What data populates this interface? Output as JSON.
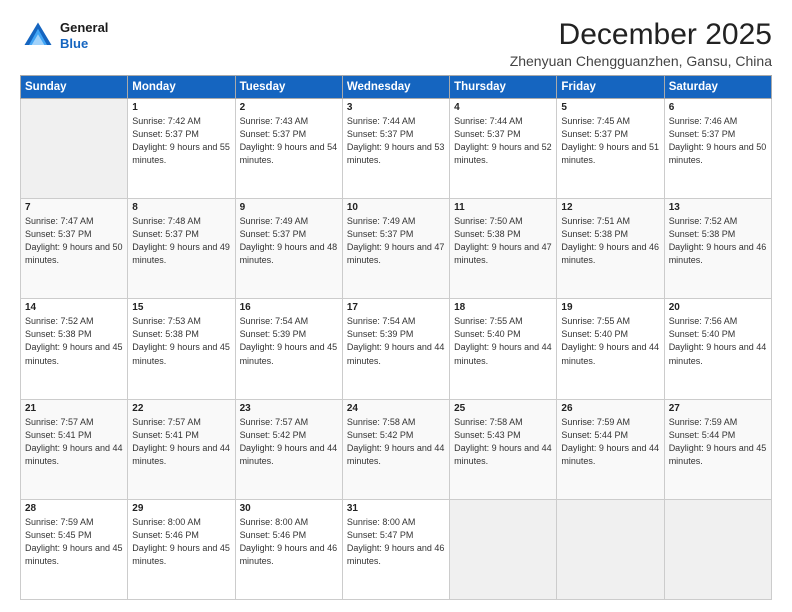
{
  "logo": {
    "line1": "General",
    "line2": "Blue"
  },
  "title": "December 2025",
  "location": "Zhenyuan Chengguanzhen, Gansu, China",
  "weekdays": [
    "Sunday",
    "Monday",
    "Tuesday",
    "Wednesday",
    "Thursday",
    "Friday",
    "Saturday"
  ],
  "weeks": [
    [
      {
        "day": "",
        "content": ""
      },
      {
        "day": "1",
        "content": "Sunrise: 7:42 AM\nSunset: 5:37 PM\nDaylight: 9 hours\nand 55 minutes."
      },
      {
        "day": "2",
        "content": "Sunrise: 7:43 AM\nSunset: 5:37 PM\nDaylight: 9 hours\nand 54 minutes."
      },
      {
        "day": "3",
        "content": "Sunrise: 7:44 AM\nSunset: 5:37 PM\nDaylight: 9 hours\nand 53 minutes."
      },
      {
        "day": "4",
        "content": "Sunrise: 7:44 AM\nSunset: 5:37 PM\nDaylight: 9 hours\nand 52 minutes."
      },
      {
        "day": "5",
        "content": "Sunrise: 7:45 AM\nSunset: 5:37 PM\nDaylight: 9 hours\nand 51 minutes."
      },
      {
        "day": "6",
        "content": "Sunrise: 7:46 AM\nSunset: 5:37 PM\nDaylight: 9 hours\nand 50 minutes."
      }
    ],
    [
      {
        "day": "7",
        "content": "Sunrise: 7:47 AM\nSunset: 5:37 PM\nDaylight: 9 hours\nand 50 minutes."
      },
      {
        "day": "8",
        "content": "Sunrise: 7:48 AM\nSunset: 5:37 PM\nDaylight: 9 hours\nand 49 minutes."
      },
      {
        "day": "9",
        "content": "Sunrise: 7:49 AM\nSunset: 5:37 PM\nDaylight: 9 hours\nand 48 minutes."
      },
      {
        "day": "10",
        "content": "Sunrise: 7:49 AM\nSunset: 5:37 PM\nDaylight: 9 hours\nand 47 minutes."
      },
      {
        "day": "11",
        "content": "Sunrise: 7:50 AM\nSunset: 5:38 PM\nDaylight: 9 hours\nand 47 minutes."
      },
      {
        "day": "12",
        "content": "Sunrise: 7:51 AM\nSunset: 5:38 PM\nDaylight: 9 hours\nand 46 minutes."
      },
      {
        "day": "13",
        "content": "Sunrise: 7:52 AM\nSunset: 5:38 PM\nDaylight: 9 hours\nand 46 minutes."
      }
    ],
    [
      {
        "day": "14",
        "content": "Sunrise: 7:52 AM\nSunset: 5:38 PM\nDaylight: 9 hours\nand 45 minutes."
      },
      {
        "day": "15",
        "content": "Sunrise: 7:53 AM\nSunset: 5:38 PM\nDaylight: 9 hours\nand 45 minutes."
      },
      {
        "day": "16",
        "content": "Sunrise: 7:54 AM\nSunset: 5:39 PM\nDaylight: 9 hours\nand 45 minutes."
      },
      {
        "day": "17",
        "content": "Sunrise: 7:54 AM\nSunset: 5:39 PM\nDaylight: 9 hours\nand 44 minutes."
      },
      {
        "day": "18",
        "content": "Sunrise: 7:55 AM\nSunset: 5:40 PM\nDaylight: 9 hours\nand 44 minutes."
      },
      {
        "day": "19",
        "content": "Sunrise: 7:55 AM\nSunset: 5:40 PM\nDaylight: 9 hours\nand 44 minutes."
      },
      {
        "day": "20",
        "content": "Sunrise: 7:56 AM\nSunset: 5:40 PM\nDaylight: 9 hours\nand 44 minutes."
      }
    ],
    [
      {
        "day": "21",
        "content": "Sunrise: 7:57 AM\nSunset: 5:41 PM\nDaylight: 9 hours\nand 44 minutes."
      },
      {
        "day": "22",
        "content": "Sunrise: 7:57 AM\nSunset: 5:41 PM\nDaylight: 9 hours\nand 44 minutes."
      },
      {
        "day": "23",
        "content": "Sunrise: 7:57 AM\nSunset: 5:42 PM\nDaylight: 9 hours\nand 44 minutes."
      },
      {
        "day": "24",
        "content": "Sunrise: 7:58 AM\nSunset: 5:42 PM\nDaylight: 9 hours\nand 44 minutes."
      },
      {
        "day": "25",
        "content": "Sunrise: 7:58 AM\nSunset: 5:43 PM\nDaylight: 9 hours\nand 44 minutes."
      },
      {
        "day": "26",
        "content": "Sunrise: 7:59 AM\nSunset: 5:44 PM\nDaylight: 9 hours\nand 44 minutes."
      },
      {
        "day": "27",
        "content": "Sunrise: 7:59 AM\nSunset: 5:44 PM\nDaylight: 9 hours\nand 45 minutes."
      }
    ],
    [
      {
        "day": "28",
        "content": "Sunrise: 7:59 AM\nSunset: 5:45 PM\nDaylight: 9 hours\nand 45 minutes."
      },
      {
        "day": "29",
        "content": "Sunrise: 8:00 AM\nSunset: 5:46 PM\nDaylight: 9 hours\nand 45 minutes."
      },
      {
        "day": "30",
        "content": "Sunrise: 8:00 AM\nSunset: 5:46 PM\nDaylight: 9 hours\nand 46 minutes."
      },
      {
        "day": "31",
        "content": "Sunrise: 8:00 AM\nSunset: 5:47 PM\nDaylight: 9 hours\nand 46 minutes."
      },
      {
        "day": "",
        "content": ""
      },
      {
        "day": "",
        "content": ""
      },
      {
        "day": "",
        "content": ""
      }
    ]
  ]
}
